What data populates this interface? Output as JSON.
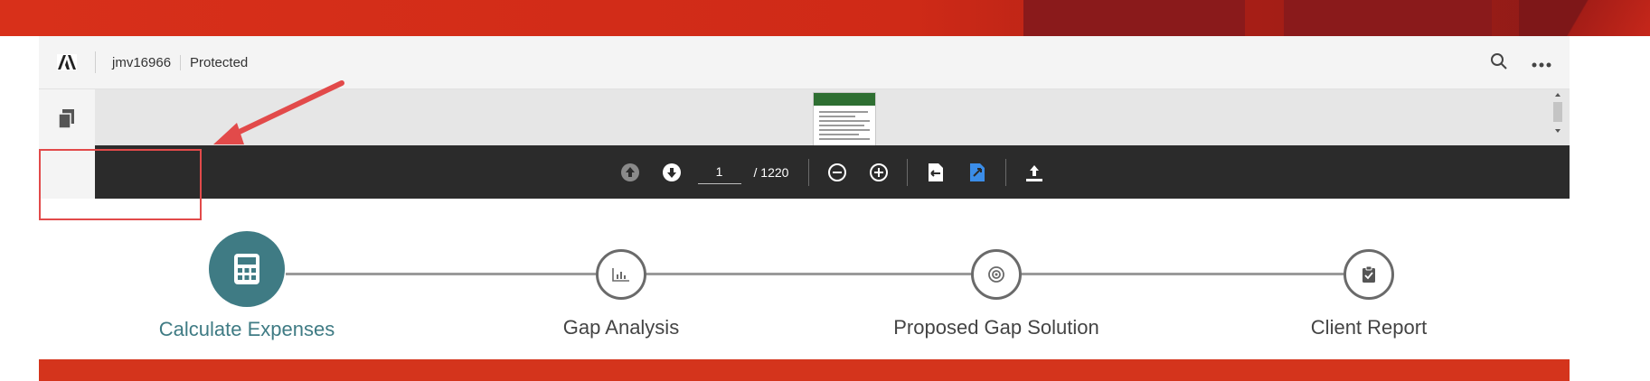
{
  "viewer": {
    "doc_name": "jmv16966",
    "doc_status": "Protected",
    "icons": {
      "logo": "adobe-logo-icon",
      "search": "search-icon",
      "more": "more-icon",
      "pages": "pages-icon"
    }
  },
  "pdf_toolbar": {
    "current_page": "1",
    "total_pages": "/ 1220",
    "icons": [
      "page-up-icon",
      "page-down-icon",
      "zoom-out-icon",
      "zoom-in-icon",
      "fit-page-icon",
      "fit-width-icon",
      "upload-icon"
    ]
  },
  "stepper": {
    "steps": [
      {
        "label": "Calculate Expenses",
        "icon": "calculator-icon",
        "active": true
      },
      {
        "label": "Gap Analysis",
        "icon": "chart-icon",
        "active": false
      },
      {
        "label": "Proposed Gap Solution",
        "icon": "target-icon",
        "active": false
      },
      {
        "label": "Client Report",
        "icon": "clipboard-icon",
        "active": false
      }
    ]
  },
  "colors": {
    "accent": "#3f7b84",
    "brand_red": "#d4341c",
    "annotation": "#e24a4a",
    "toolbar_bg": "#2b2b2b"
  }
}
